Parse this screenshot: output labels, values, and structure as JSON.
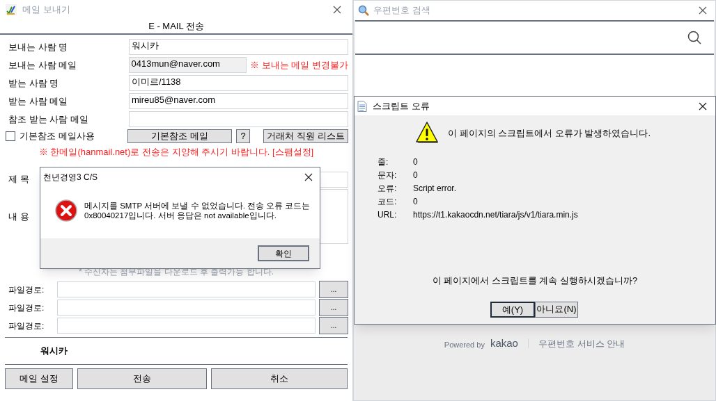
{
  "mail_window": {
    "title": "메일 보내기",
    "heading": "E - MAIL 전송",
    "fields": [
      {
        "label": "보내는 사람 명",
        "value": "워시카",
        "disabled": false
      },
      {
        "label": "보내는 사람 메일",
        "value": "0413mun@naver.com",
        "disabled": true,
        "note": "※ 보내는 메일 변경불가"
      },
      {
        "label": "받는 사람 명",
        "value": "이미르/1138",
        "disabled": false
      },
      {
        "label": "받는 사람 메일",
        "value": "mireu85@naver.com",
        "disabled": false
      },
      {
        "label": "참조 받는 사람 메일",
        "disabled": false
      }
    ],
    "default_cc": {
      "label": "기본참조 메일사용",
      "checked": false
    },
    "cc_buttons": [
      "기본참조 메일",
      "?",
      "거래처 직원 리스트"
    ],
    "notice": "※ 한메일(hanmail.net)로 전송은 지양해 주시기 바랍니다. [스팸설정]",
    "subject_label": "제 목",
    "content_label": "내 용",
    "attachment_note": "* 수신자는 첨부파일을 다운로드 후 출력가능 합니다.",
    "attachments": [
      {
        "label": "파일경로:",
        "button": "..."
      },
      {
        "label": "파일경로:",
        "button": "..."
      },
      {
        "label": "파일경로:",
        "button": "..."
      }
    ],
    "signature": "워시카",
    "buttons": [
      "메일 설정",
      "전송",
      "취소"
    ]
  },
  "error_dialog": {
    "title": "천년경영3 C/S",
    "message": "메시지를 SMTP 서버에 보낼 수 없었습니다. 전송 오류 코드는 0x80040217입니다. 서버 응답은 not available입니다.",
    "button": "확인"
  },
  "postcode_window": {
    "title": "우편번호 검색",
    "footer": {
      "powered_by": "Powered by",
      "brand": "kakao",
      "link": "우편번호 서비스 안내"
    }
  },
  "script_error_dialog": {
    "title": "스크립트 오류",
    "heading": "이 페이지의 스크립트에서 오류가 발생하였습니다.",
    "details": [
      {
        "label": "줄:",
        "value": "0"
      },
      {
        "label": "문자:",
        "value": "0"
      },
      {
        "label": "오류:",
        "value": "Script error."
      },
      {
        "label": "코드:",
        "value": "0"
      },
      {
        "label": "URL:",
        "value": "https://t1.kakaocdn.net/tiara/js/v1/tiara.min.js"
      }
    ],
    "question": "이 페이지에서 스크립트를 계속 실행하시겠습니까?",
    "buttons": [
      {
        "label": "예(Y)",
        "default": true
      },
      {
        "label": "아니요(N)",
        "default": false
      }
    ]
  }
}
